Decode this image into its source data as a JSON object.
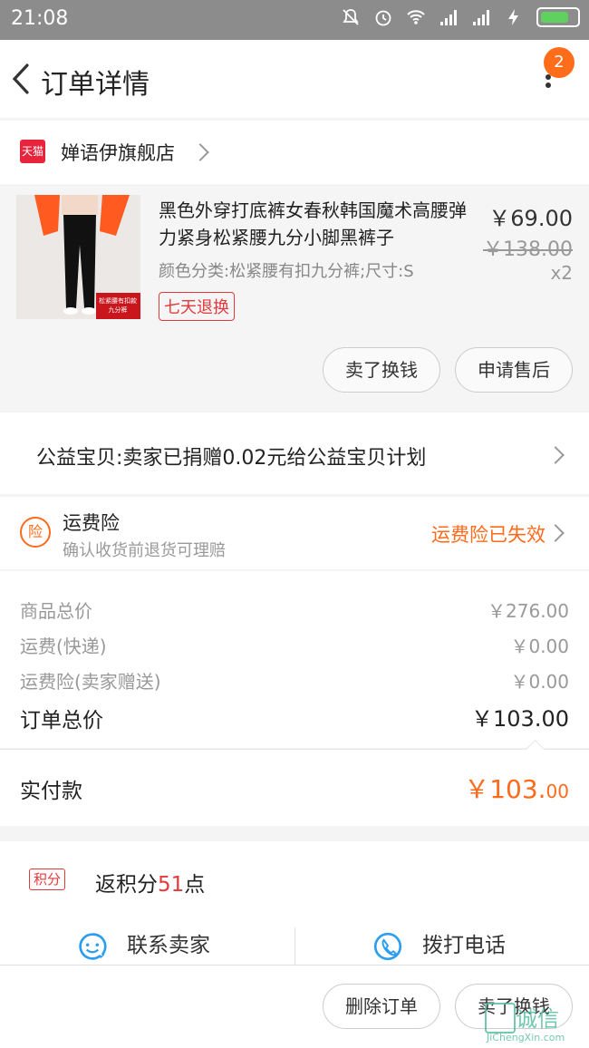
{
  "status_bar": {
    "time": "21:08"
  },
  "header": {
    "title": "订单详情",
    "badge_count": "2"
  },
  "shop": {
    "logo_text": "天猫",
    "name": "婵语伊旗舰店"
  },
  "item": {
    "title": "黑色外穿打底裤女春秋韩国魔术高腰弹力紧身松紧腰九分小脚黑裤子",
    "sku": "颜色分类:松紧腰有扣九分裤;尺寸:S",
    "return_tag": "七天退换",
    "price": "￥69.00",
    "original_price": "￥138.00",
    "quantity": "x2",
    "thumb_caption": "松紧腰有扣款九分裤",
    "buttons": {
      "sell": "卖了换钱",
      "after_sale": "申请售后"
    }
  },
  "charity": {
    "text": "公益宝贝:卖家已捐赠0.02元给公益宝贝计划"
  },
  "insurance": {
    "icon_text": "险",
    "title": "运费险",
    "subtitle": "确认收货前退货可理赔",
    "status": "运费险已失效"
  },
  "totals": {
    "goods_label": "商品总价",
    "goods_value": "￥276.00",
    "shipping_label": "运费(快递)",
    "shipping_value": "￥0.00",
    "insurance_label": "运费险(卖家赠送)",
    "insurance_value": "￥0.00",
    "order_total_label": "订单总价",
    "order_total_value": "￥103.00"
  },
  "paid": {
    "label": "实付款",
    "value_main": "￥103.",
    "value_decimal": "00"
  },
  "points": {
    "tag": "积分",
    "text_prefix": "返积分",
    "number": "51",
    "text_suffix": "点"
  },
  "contact": {
    "seller": "联系卖家",
    "phone": "拨打电话"
  },
  "bottom": {
    "delete": "删除订单",
    "sell": "卖了换钱"
  },
  "watermark": {
    "text": "诚信",
    "url": "JiChengXin.com"
  },
  "colors": {
    "accent": "#ff6a1b",
    "red": "#e4393c",
    "blue": "#2b9ef0"
  }
}
